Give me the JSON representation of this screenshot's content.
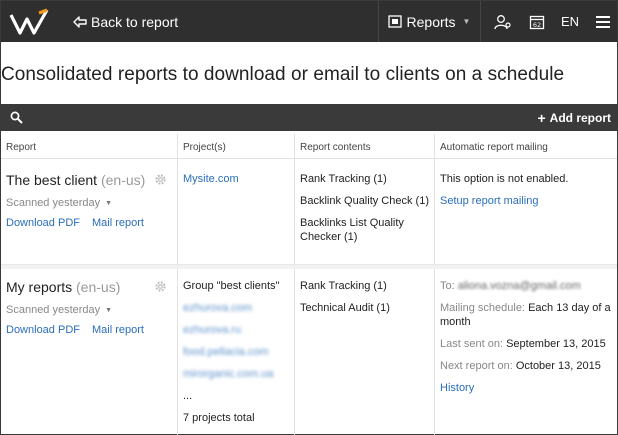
{
  "topbar": {
    "back_label": "Back to report",
    "reports_label": "Reports",
    "lang_label": "EN"
  },
  "page": {
    "title": "Consolidated reports to download or email to clients on a schedule"
  },
  "toolbar": {
    "add_report_label": "Add report"
  },
  "table": {
    "headers": [
      "Report",
      "Project(s)",
      "Report contents",
      "Automatic report mailing"
    ],
    "rows": [
      {
        "name": "The best client",
        "locale": "(en-us)",
        "scanned": "Scanned yesterday",
        "download_label": "Download PDF",
        "mail_label": "Mail report",
        "projects": [
          "Mysite.com"
        ],
        "contents": [
          "Rank Tracking (1)",
          "Backlink Quality Check (1)",
          "Backlinks List Quality Checker (1)"
        ],
        "mailing": {
          "status": "This option is not enabled.",
          "setup_label": "Setup report mailing"
        }
      },
      {
        "name": "My reports",
        "locale": "(en-us)",
        "scanned": "Scanned yesterday",
        "download_label": "Download PDF",
        "mail_label": "Mail report",
        "group": "Group \"best clients\"",
        "projects": [
          "ezhurova.com",
          "ezhurova.ru",
          "food.pellacia.com",
          "mirorganic.com.ua"
        ],
        "more": "...",
        "total": "7 projects total",
        "contents": [
          "Rank Tracking (1)",
          "Technical Audit (1)"
        ],
        "mailing": {
          "to_label": "To:",
          "to_value": "aliona.vozna@gmail.com",
          "schedule_label": "Mailing schedule:",
          "schedule_value": "Each 13 day of a month",
          "last_label": "Last sent on:",
          "last_value": "September 13, 2015",
          "next_label": "Next report on:",
          "next_value": "October 13, 2015",
          "history_label": "History"
        }
      }
    ]
  },
  "colors": {
    "topbar_bg": "#2f2f2f",
    "searchbar_bg": "#3a3a3a",
    "link": "#2a6ebb"
  }
}
